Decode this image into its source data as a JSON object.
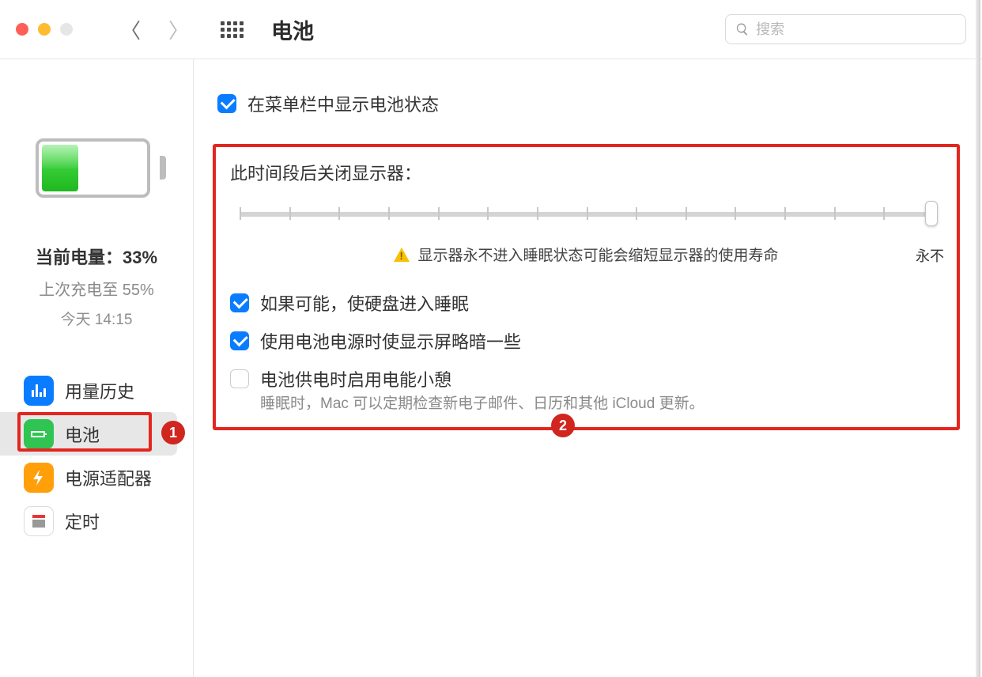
{
  "titlebar": {
    "title": "电池",
    "search_placeholder": "搜索"
  },
  "sidebar": {
    "current_level_label": "当前电量：",
    "current_level_value": "33%",
    "last_charge": "上次充电至 55%",
    "last_charge_time": "今天 14:15",
    "items": [
      {
        "label": "用量历史"
      },
      {
        "label": "电池"
      },
      {
        "label": "电源适配器"
      },
      {
        "label": "定时"
      }
    ]
  },
  "content": {
    "show_in_menubar": "在菜单栏中显示电池状态",
    "display_off_title": "此时间段后关闭显示器：",
    "slider_end_label": "永不",
    "warn_text": "显示器永不进入睡眠状态可能会缩短显示器的使用寿命",
    "opt_hd_sleep": "如果可能，使硬盘进入睡眠",
    "opt_dim_display": "使用电池电源时使显示屏略暗一些",
    "opt_power_nap": "电池供电时启用电能小憩",
    "power_nap_helper": "睡眠时，Mac 可以定期检查新电子邮件、日历和其他 iCloud 更新。"
  },
  "annotations": {
    "badge1": "1",
    "badge2": "2"
  }
}
